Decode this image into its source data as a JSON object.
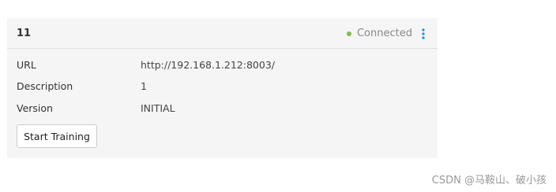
{
  "card": {
    "title": "11",
    "status": {
      "text": "Connected",
      "color": "#7cc04b"
    },
    "menu_icon": "more-vertical-icon",
    "menu_icon_color": "#1a8fd6",
    "fields": [
      {
        "label": "URL",
        "value": "http://192.168.1.212:8003/"
      },
      {
        "label": "Description",
        "value": "1"
      },
      {
        "label": "Version",
        "value": "INITIAL"
      }
    ],
    "start_button_label": "Start Training"
  },
  "watermark": "CSDN @马鞍山、破小孩"
}
